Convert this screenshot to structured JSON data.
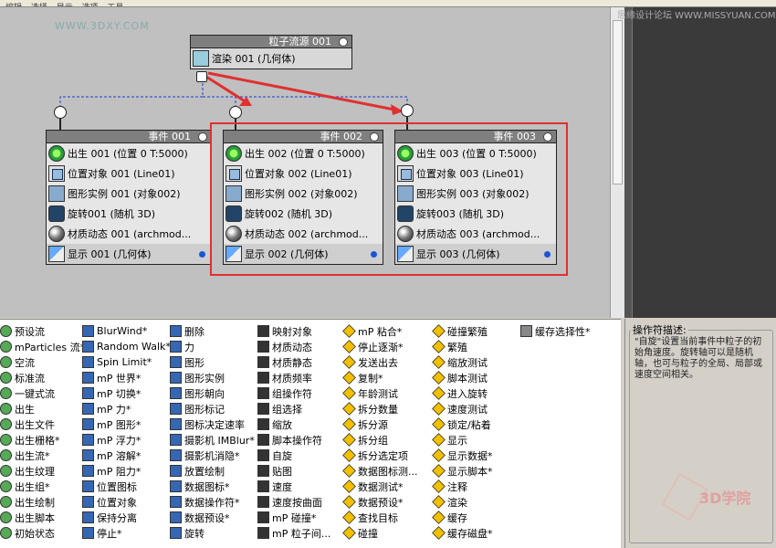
{
  "menubar": {
    "items": [
      "编辑",
      "选择",
      "显示",
      "选项",
      "工具"
    ]
  },
  "watermark": {
    "site": "WWW.3DXY.COM",
    "forum": "思缘设计论坛 WWW.MISSYUAN.COM",
    "logo_text": "3D学院"
  },
  "source": {
    "title": "粒子流源 001",
    "op": "渲染 001 (几何体)"
  },
  "events": [
    {
      "title": "事件 001",
      "ops": [
        "出生 001 (位置 0 T:5000)",
        "位置对象 001 (Line01)",
        "图形实例 001 (对象002)",
        "旋转001 (随机 3D)",
        "材质动态 001 (archmod...",
        "显示 001 (几何体)"
      ]
    },
    {
      "title": "事件 002",
      "ops": [
        "出生 002 (位置 0 T:5000)",
        "位置对象 002 (Line01)",
        "图形实例 002 (对象002)",
        "旋转002 (随机 3D)",
        "材质动态 002 (archmod...",
        "显示 002 (几何体)"
      ]
    },
    {
      "title": "事件 003",
      "ops": [
        "出生 003 (位置 0 T:5000)",
        "位置对象 003 (Line01)",
        "图形实例 003 (对象002)",
        "旋转003 (随机 3D)",
        "材质动态 003 (archmod...",
        "显示 003 (几何体)"
      ]
    }
  ],
  "depot": {
    "col1": [
      "预设流",
      "mParticles 流*",
      "空流",
      "标准流",
      "一键式流",
      "出生",
      "出生文件",
      "出生栅格*",
      "出生流*",
      "出生纹理",
      "出生组*",
      "出生绘制",
      "出生脚本",
      "初始状态"
    ],
    "col2": [
      "BlurWind*",
      "Random Walk*",
      "Spin Limit*",
      "mP 世界*",
      "mP 切换*",
      "mP 力*",
      "mP 图形*",
      "mP 浮力*",
      "mP 溶解*",
      "mP 阻力*",
      "位置图标",
      "位置对象",
      "保持分离",
      "停止*"
    ],
    "col3": [
      "删除",
      "力",
      "图形",
      "图形实例",
      "图形朝向",
      "图形标记",
      "图标决定速率",
      "摄影机 IMBlur*",
      "摄影机消隐*",
      "放置绘制",
      "数据图标*",
      "数据操作符*",
      "数据预设*",
      "旋转"
    ],
    "col4": [
      "映射对象",
      "材质动态",
      "材质静态",
      "材质频率",
      "组操作符",
      "组选择",
      "缩放",
      "脚本操作符",
      "自旋",
      "贴图",
      "速度",
      "速度按曲面",
      "mP 碰撞*",
      "mP 粒子间..."
    ],
    "col5": [
      "mP 粘合*",
      "停止逐渐*",
      "发送出去",
      "复制*",
      "年龄测试",
      "拆分数量",
      "拆分源",
      "拆分组",
      "拆分选定项",
      "数据图标测...",
      "数据测试*",
      "数据预设*",
      "查找目标",
      "碰撞"
    ],
    "col6": [
      "碰撞繁殖",
      "繁殖",
      "缩放测试",
      "脚本测试",
      "进入旋转",
      "速度测试",
      "锁定/粘着",
      "显示",
      "显示数据*",
      "显示脚本*",
      "注释",
      "渲染",
      "缓存",
      "缓存磁盘*"
    ],
    "col7": [
      "缓存选择性*"
    ]
  },
  "description": {
    "legend": "操作符描述:",
    "text": "\"自旋\"设置当前事件中粒子的初始角速度。旋转轴可以是随机轴，也可与粒子的全局、局部或速度空间相关。"
  },
  "colors": {
    "canvas": "#c0c0c0",
    "highlight": "#e03030",
    "arrow": "#e03030",
    "wire": "#1a3cd8"
  }
}
